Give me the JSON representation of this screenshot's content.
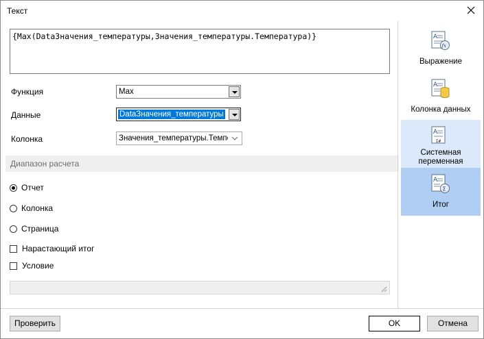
{
  "window": {
    "title": "Текст"
  },
  "expression": "{Max(DataЗначения_температуры,Значения_температуры.Температура)}",
  "fields": {
    "function": {
      "label": "Функция",
      "value": "Max"
    },
    "data": {
      "label": "Данные",
      "value": "DataЗначения_температуры"
    },
    "column": {
      "label": "Колонка",
      "value": "Значения_температуры.Темпер"
    }
  },
  "range": {
    "header": "Диапазон расчета",
    "options": [
      "Отчет",
      "Колонка",
      "Страница"
    ],
    "selected": "Отчет"
  },
  "checks": {
    "cumulative": "Нарастающий итог",
    "condition": "Условие"
  },
  "sidebar": {
    "items": [
      {
        "label": "Выражение",
        "icon": "expression-fx-icon"
      },
      {
        "label": "Колонка данных",
        "icon": "data-column-icon"
      },
      {
        "label": "Системная переменная",
        "icon": "system-variable-icon"
      },
      {
        "label": "Итог",
        "icon": "summary-sigma-icon"
      }
    ],
    "hovered": "Системная переменная",
    "selected": "Итог"
  },
  "buttons": {
    "check": "Проверить",
    "ok": "OK",
    "cancel": "Отмена"
  },
  "colors": {
    "selection": "#0078d7",
    "sidebar_selected": "#b0cdf3",
    "sidebar_hover": "#dbe9fa"
  }
}
